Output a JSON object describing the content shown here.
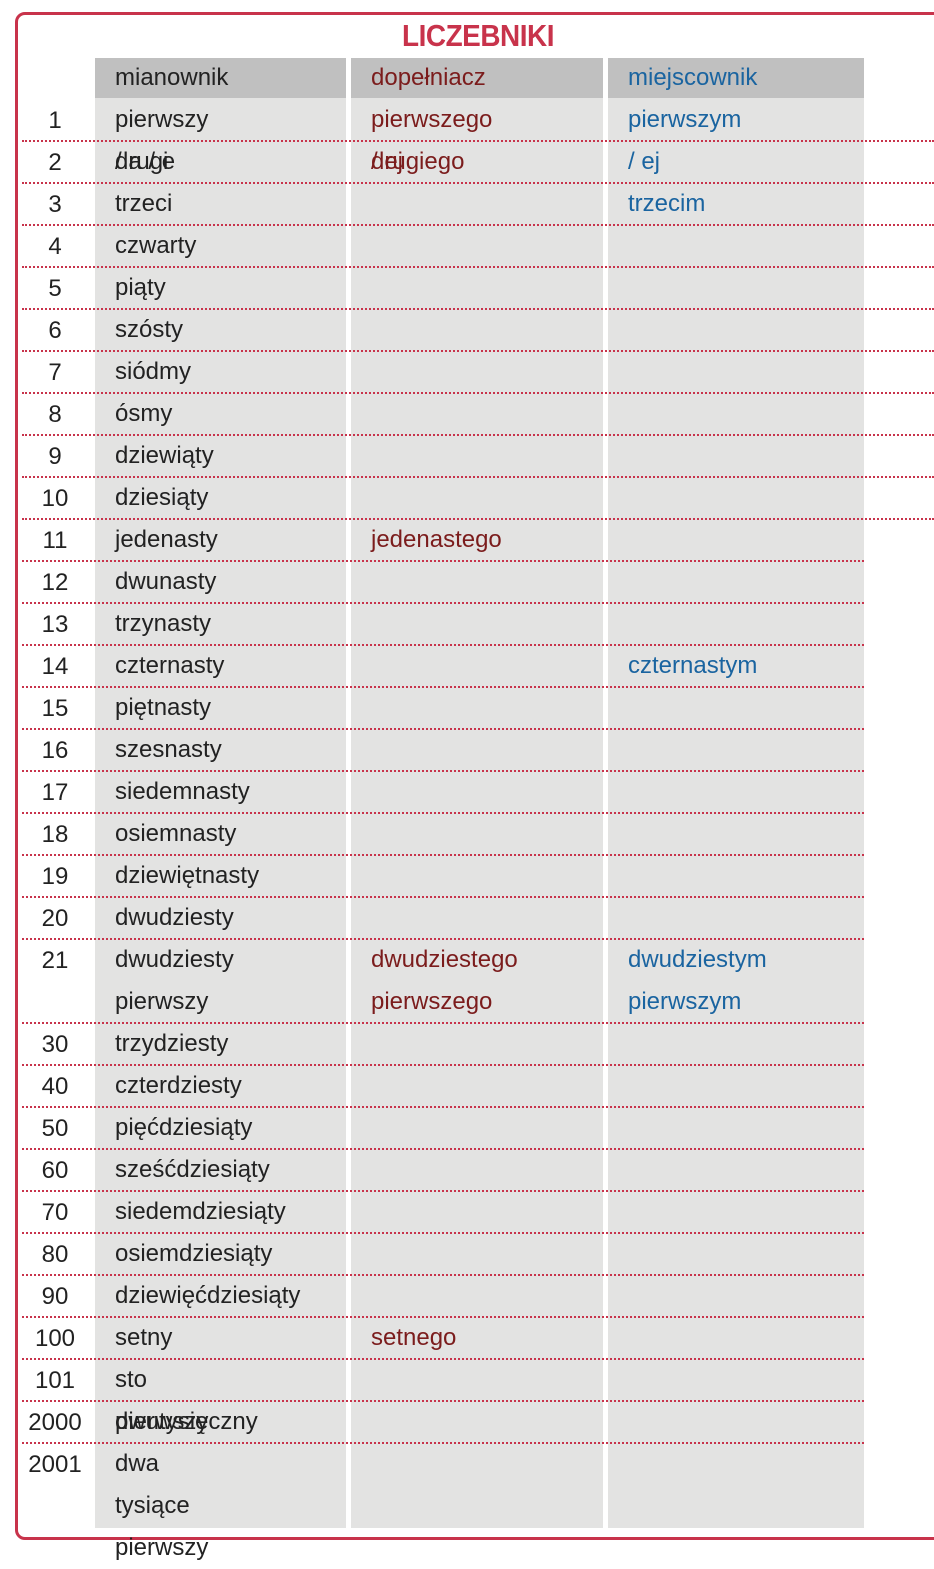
{
  "title": "LICZEBNIKI",
  "headers": [
    "mianownik",
    "dopełniacz",
    "miejscownik"
  ],
  "colors": {
    "accent": "#c8334b",
    "genitive": "#7b1c1c",
    "locative": "#1a64a0"
  },
  "rows": [
    {
      "n": "1",
      "nom": [
        "pierwszy / a / e"
      ],
      "gen": [
        "pierwszego / ej"
      ],
      "loc": [
        "pierwszym / ej"
      ]
    },
    {
      "n": "2",
      "nom": [
        "drugi"
      ],
      "gen": [
        "drugiego"
      ],
      "loc": []
    },
    {
      "n": "3",
      "nom": [
        "trzeci"
      ],
      "gen": [],
      "loc": [
        "trzecim"
      ]
    },
    {
      "n": "4",
      "nom": [
        "czwarty"
      ],
      "gen": [],
      "loc": []
    },
    {
      "n": "5",
      "nom": [
        "piąty"
      ],
      "gen": [],
      "loc": []
    },
    {
      "n": "6",
      "nom": [
        "szósty"
      ],
      "gen": [],
      "loc": []
    },
    {
      "n": "7",
      "nom": [
        "siódmy"
      ],
      "gen": [],
      "loc": []
    },
    {
      "n": "8",
      "nom": [
        "ósmy"
      ],
      "gen": [],
      "loc": []
    },
    {
      "n": "9",
      "nom": [
        "dziewiąty"
      ],
      "gen": [],
      "loc": []
    },
    {
      "n": "10",
      "nom": [
        "dziesiąty"
      ],
      "gen": [],
      "loc": []
    },
    {
      "n": "11",
      "nom": [
        "jedenasty"
      ],
      "gen": [
        "jedenastego"
      ],
      "loc": []
    },
    {
      "n": "12",
      "nom": [
        "dwunasty"
      ],
      "gen": [],
      "loc": []
    },
    {
      "n": "13",
      "nom": [
        "trzynasty"
      ],
      "gen": [],
      "loc": []
    },
    {
      "n": "14",
      "nom": [
        "czternasty"
      ],
      "gen": [],
      "loc": [
        "czternastym"
      ]
    },
    {
      "n": "15",
      "nom": [
        "piętnasty"
      ],
      "gen": [],
      "loc": []
    },
    {
      "n": "16",
      "nom": [
        "szesnasty"
      ],
      "gen": [],
      "loc": []
    },
    {
      "n": "17",
      "nom": [
        "siedemnasty"
      ],
      "gen": [],
      "loc": []
    },
    {
      "n": "18",
      "nom": [
        "osiemnasty"
      ],
      "gen": [],
      "loc": []
    },
    {
      "n": "19",
      "nom": [
        "dziewiętnasty"
      ],
      "gen": [],
      "loc": []
    },
    {
      "n": "20",
      "nom": [
        "dwudziesty"
      ],
      "gen": [],
      "loc": []
    },
    {
      "n": "21",
      "nom": [
        "dwudziesty",
        "pierwszy"
      ],
      "gen": [
        "dwudziestego",
        "pierwszego"
      ],
      "loc": [
        "dwudziestym",
        "pierwszym"
      ]
    },
    {
      "n": "30",
      "nom": [
        "trzydziesty"
      ],
      "gen": [],
      "loc": []
    },
    {
      "n": "40",
      "nom": [
        "czterdziesty"
      ],
      "gen": [],
      "loc": []
    },
    {
      "n": "50",
      "nom": [
        "pięćdziesiąty"
      ],
      "gen": [],
      "loc": []
    },
    {
      "n": "60",
      "nom": [
        "sześćdziesiąty"
      ],
      "gen": [],
      "loc": []
    },
    {
      "n": "70",
      "nom": [
        "siedemdziesiąty"
      ],
      "gen": [],
      "loc": []
    },
    {
      "n": "80",
      "nom": [
        "osiemdziesiąty"
      ],
      "gen": [],
      "loc": []
    },
    {
      "n": "90",
      "nom": [
        "dziewięćdziesiąty"
      ],
      "gen": [],
      "loc": []
    },
    {
      "n": "100",
      "nom": [
        "setny"
      ],
      "gen": [
        "setnego"
      ],
      "loc": []
    },
    {
      "n": "101",
      "nom": [
        "sto pierwszy"
      ],
      "gen": [],
      "loc": []
    },
    {
      "n": "2000",
      "nom": [
        "dwutysięczny"
      ],
      "gen": [],
      "loc": []
    },
    {
      "n": "2001",
      "nom": [
        "dwa tysiące",
        "pierwszy"
      ],
      "gen": [],
      "loc": []
    }
  ]
}
